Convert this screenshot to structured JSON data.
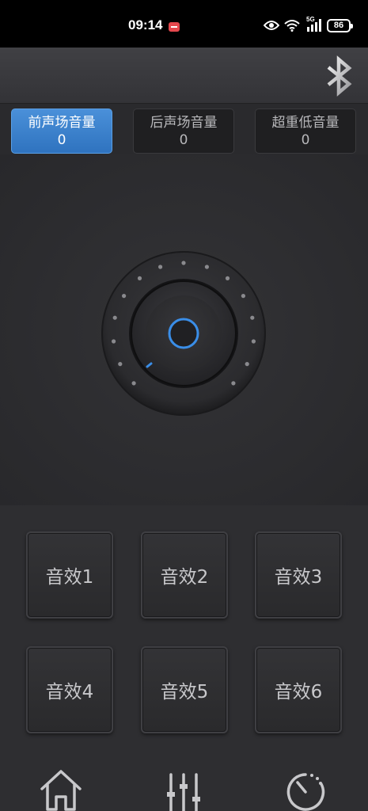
{
  "status_bar": {
    "time": "09:14",
    "network": "5G",
    "battery": "86"
  },
  "header": {
    "bluetooth_icon": "bluetooth-icon"
  },
  "channels": [
    {
      "label": "前声场音量",
      "value": "0",
      "active": true
    },
    {
      "label": "后声场音量",
      "value": "0",
      "active": false
    },
    {
      "label": "超重低音量",
      "value": "0",
      "active": false
    }
  ],
  "knob": {
    "level": 0,
    "accent": "#3a8ee8"
  },
  "presets": [
    {
      "label": "音效1"
    },
    {
      "label": "音效2"
    },
    {
      "label": "音效3"
    },
    {
      "label": "音效4"
    },
    {
      "label": "音效5"
    },
    {
      "label": "音效6"
    }
  ],
  "nav": [
    {
      "icon": "home-icon"
    },
    {
      "icon": "equalizer-icon"
    },
    {
      "icon": "timer-icon"
    }
  ]
}
